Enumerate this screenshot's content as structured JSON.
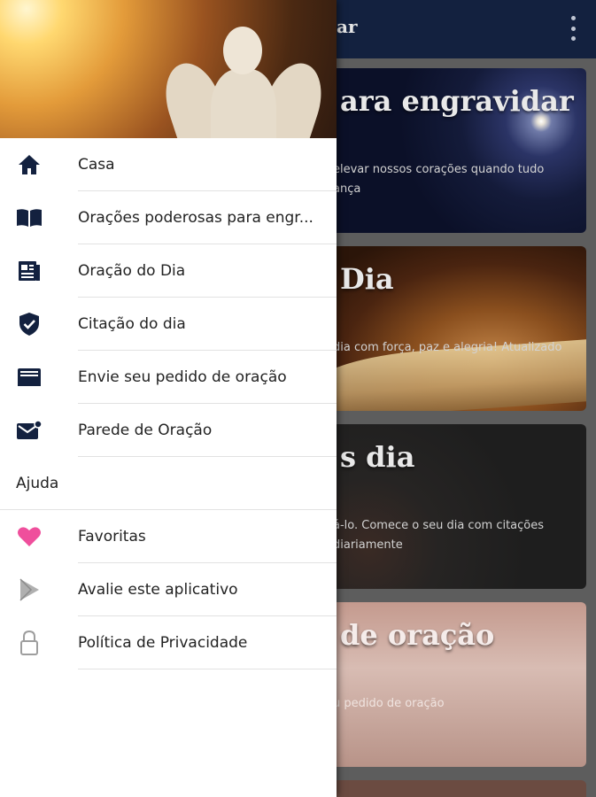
{
  "appbar": {
    "title": "ar",
    "overflow_icon": "more-vert-icon"
  },
  "cards": [
    {
      "title": "ara engravidar",
      "desc": "elevar nossos corações quando tudo\nança"
    },
    {
      "title": "Dia",
      "desc": "dia com força, paz e alegria! Atualizado"
    },
    {
      "title": "s dia",
      "desc": "á-lo. Comece o seu dia com citações\ndiariamente"
    },
    {
      "title": "de oração",
      "desc": "u pedido de oração"
    }
  ],
  "drawer": {
    "items": [
      {
        "label": "Casa",
        "icon": "home-icon"
      },
      {
        "label": "Orações poderosas para engr...",
        "icon": "book-open-icon"
      },
      {
        "label": "Oração do Dia",
        "icon": "newspaper-icon"
      },
      {
        "label": "Citação do dia",
        "icon": "shield-check-icon"
      },
      {
        "label": "Envie seu pedido de oração",
        "icon": "inbox-icon"
      },
      {
        "label": "Parede de Oração",
        "icon": "mail-badge-icon"
      }
    ],
    "section_label": "Ajuda",
    "help_items": [
      {
        "label": "Favoritas",
        "icon": "heart-icon"
      },
      {
        "label": "Avalie este aplicativo",
        "icon": "play-store-icon"
      },
      {
        "label": "Política de Privacidade",
        "icon": "lock-icon"
      }
    ]
  },
  "colors": {
    "navy": "#13213f",
    "heart": "#ef4f9c",
    "icon_grey": "#9e9e9e"
  }
}
